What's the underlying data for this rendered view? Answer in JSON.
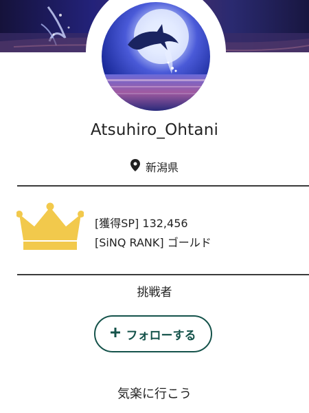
{
  "profile": {
    "username": "Atsuhiro_Ohtani",
    "location": "新潟県",
    "role": "挑戦者",
    "bio": "気楽に行こう"
  },
  "stats": {
    "sp_label": "[獲得SP]",
    "sp_value": "132,456",
    "rank_label": "[SiNQ RANK]",
    "rank_value": "ゴールド",
    "rank_icon": "crown-icon"
  },
  "follow": {
    "label": "フォローする",
    "icon": "plus-icon"
  },
  "colors": {
    "accent": "#14524a",
    "crown_fill": "#f2c94c",
    "divider": "#3a3a3a"
  }
}
